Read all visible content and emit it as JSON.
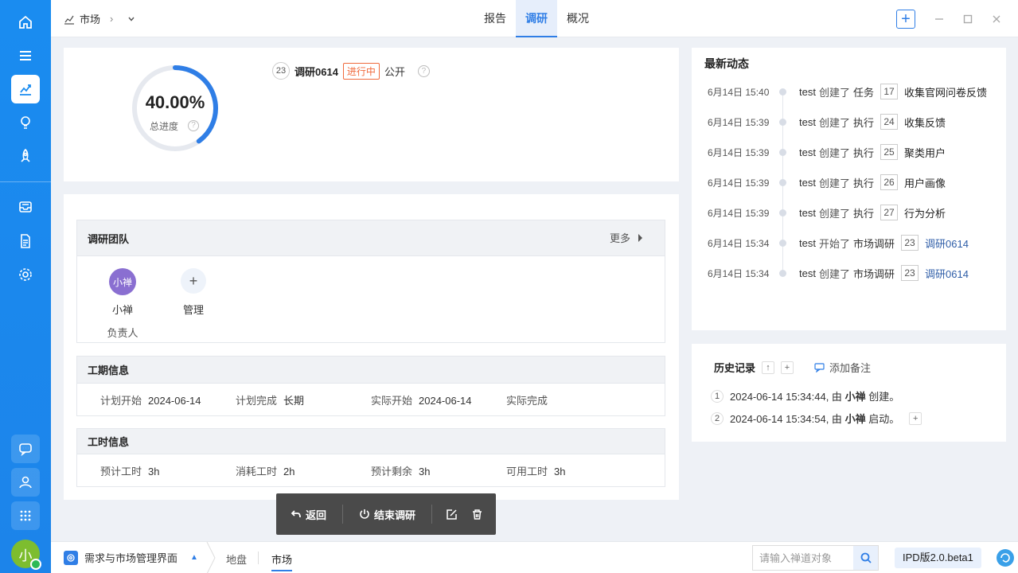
{
  "topbar": {
    "breadcrumb": "市场",
    "tabs": [
      {
        "label": "报告"
      },
      {
        "label": "调研"
      },
      {
        "label": "概况"
      }
    ]
  },
  "progress": {
    "value_text": "40.00%",
    "fraction": 0.4,
    "label": "总进度"
  },
  "research": {
    "id": "23",
    "title": "调研0614",
    "status": "进行中",
    "visibility": "公开"
  },
  "team": {
    "title": "调研团队",
    "more": "更多",
    "members": [
      {
        "avatar_text": "小禅",
        "name": "小禅",
        "role": "负责人"
      }
    ],
    "manage_label": "管理"
  },
  "schedule": {
    "title": "工期信息",
    "items": [
      {
        "label": "计划开始",
        "value": "2024-06-14"
      },
      {
        "label": "计划完成",
        "value": "长期"
      },
      {
        "label": "实际开始",
        "value": "2024-06-14"
      },
      {
        "label": "实际完成",
        "value": ""
      }
    ]
  },
  "hours": {
    "title": "工时信息",
    "items": [
      {
        "label": "预计工时",
        "value": "3h"
      },
      {
        "label": "消耗工时",
        "value": "2h"
      },
      {
        "label": "预计剩余",
        "value": "3h"
      },
      {
        "label": "可用工时",
        "value": "3h"
      }
    ]
  },
  "actions": {
    "back": "返回",
    "end": "结束调研"
  },
  "activity": {
    "title": "最新动态",
    "items": [
      {
        "time": "6月14日 15:40",
        "user": "test",
        "verb": "创建了",
        "type": "任务",
        "num": "17",
        "object": "收集官网问卷反馈",
        "link": false
      },
      {
        "time": "6月14日 15:39",
        "user": "test",
        "verb": "创建了",
        "type": "执行",
        "num": "24",
        "object": "收集反馈",
        "link": false
      },
      {
        "time": "6月14日 15:39",
        "user": "test",
        "verb": "创建了",
        "type": "执行",
        "num": "25",
        "object": "聚类用户",
        "link": false
      },
      {
        "time": "6月14日 15:39",
        "user": "test",
        "verb": "创建了",
        "type": "执行",
        "num": "26",
        "object": "用户画像",
        "link": false
      },
      {
        "time": "6月14日 15:39",
        "user": "test",
        "verb": "创建了",
        "type": "执行",
        "num": "27",
        "object": "行为分析",
        "link": false
      },
      {
        "time": "6月14日 15:34",
        "user": "test",
        "verb": "开始了",
        "type": "市场调研",
        "num": "23",
        "object": "调研0614",
        "link": true
      },
      {
        "time": "6月14日 15:34",
        "user": "test",
        "verb": "创建了",
        "type": "市场调研",
        "num": "23",
        "object": "调研0614",
        "link": true
      }
    ]
  },
  "history": {
    "title": "历史记录",
    "add_note": "添加备注",
    "items": [
      {
        "n": "1",
        "time": "2024-06-14 15:34:44, 由",
        "user": "小禅",
        "action": "创建。"
      },
      {
        "n": "2",
        "time": "2024-06-14 15:34:54, 由",
        "user": "小禅",
        "action": "启动。"
      }
    ]
  },
  "footer": {
    "app_name": "需求与市场管理界面",
    "crumbs": [
      "地盘",
      "市场"
    ],
    "search_placeholder": "请输入禅道对象",
    "version": "IPD版2.0.beta1"
  },
  "user_avatar": "小",
  "colors": {
    "accent": "#2f7ee6",
    "sidebar": "#1a8cf0",
    "status": "#f06a3c"
  }
}
